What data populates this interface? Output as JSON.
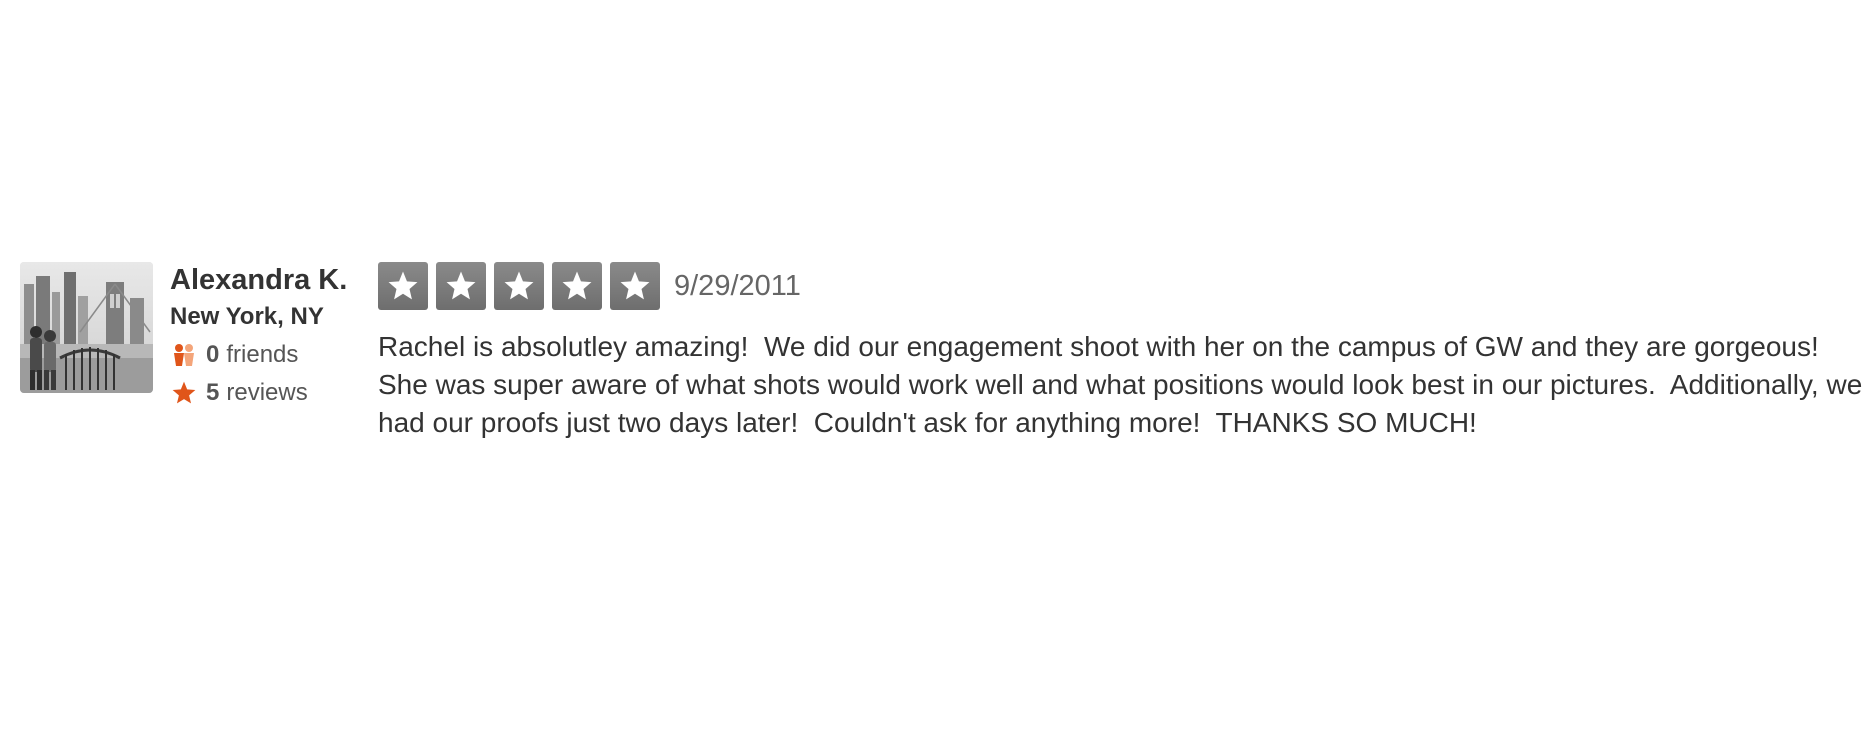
{
  "user": {
    "name": "Alexandra K.",
    "location": "New York, NY",
    "friends_count": "0",
    "friends_label": "friends",
    "reviews_count": "5",
    "reviews_label": "reviews",
    "avatar_icon": "user-photo"
  },
  "review": {
    "rating": 5,
    "rating_max": 5,
    "date": "9/29/2011",
    "text": "Rachel is absolutley amazing!  We did our engagement shoot with her on the campus of GW and they are gorgeous!  She was super aware of what shots would work well and what positions would look best in our pictures.  Additionally, we had our proofs just two days later!  Couldn't ask for anything more!  THANKS SO MUCH!"
  },
  "colors": {
    "star_fill": "#7a7a7a",
    "accent_orange": "#f15c00",
    "text": "#333333"
  },
  "icons": {
    "friends": "friends-icon",
    "reviews": "star-icon",
    "rating_star": "rating-star-icon"
  }
}
